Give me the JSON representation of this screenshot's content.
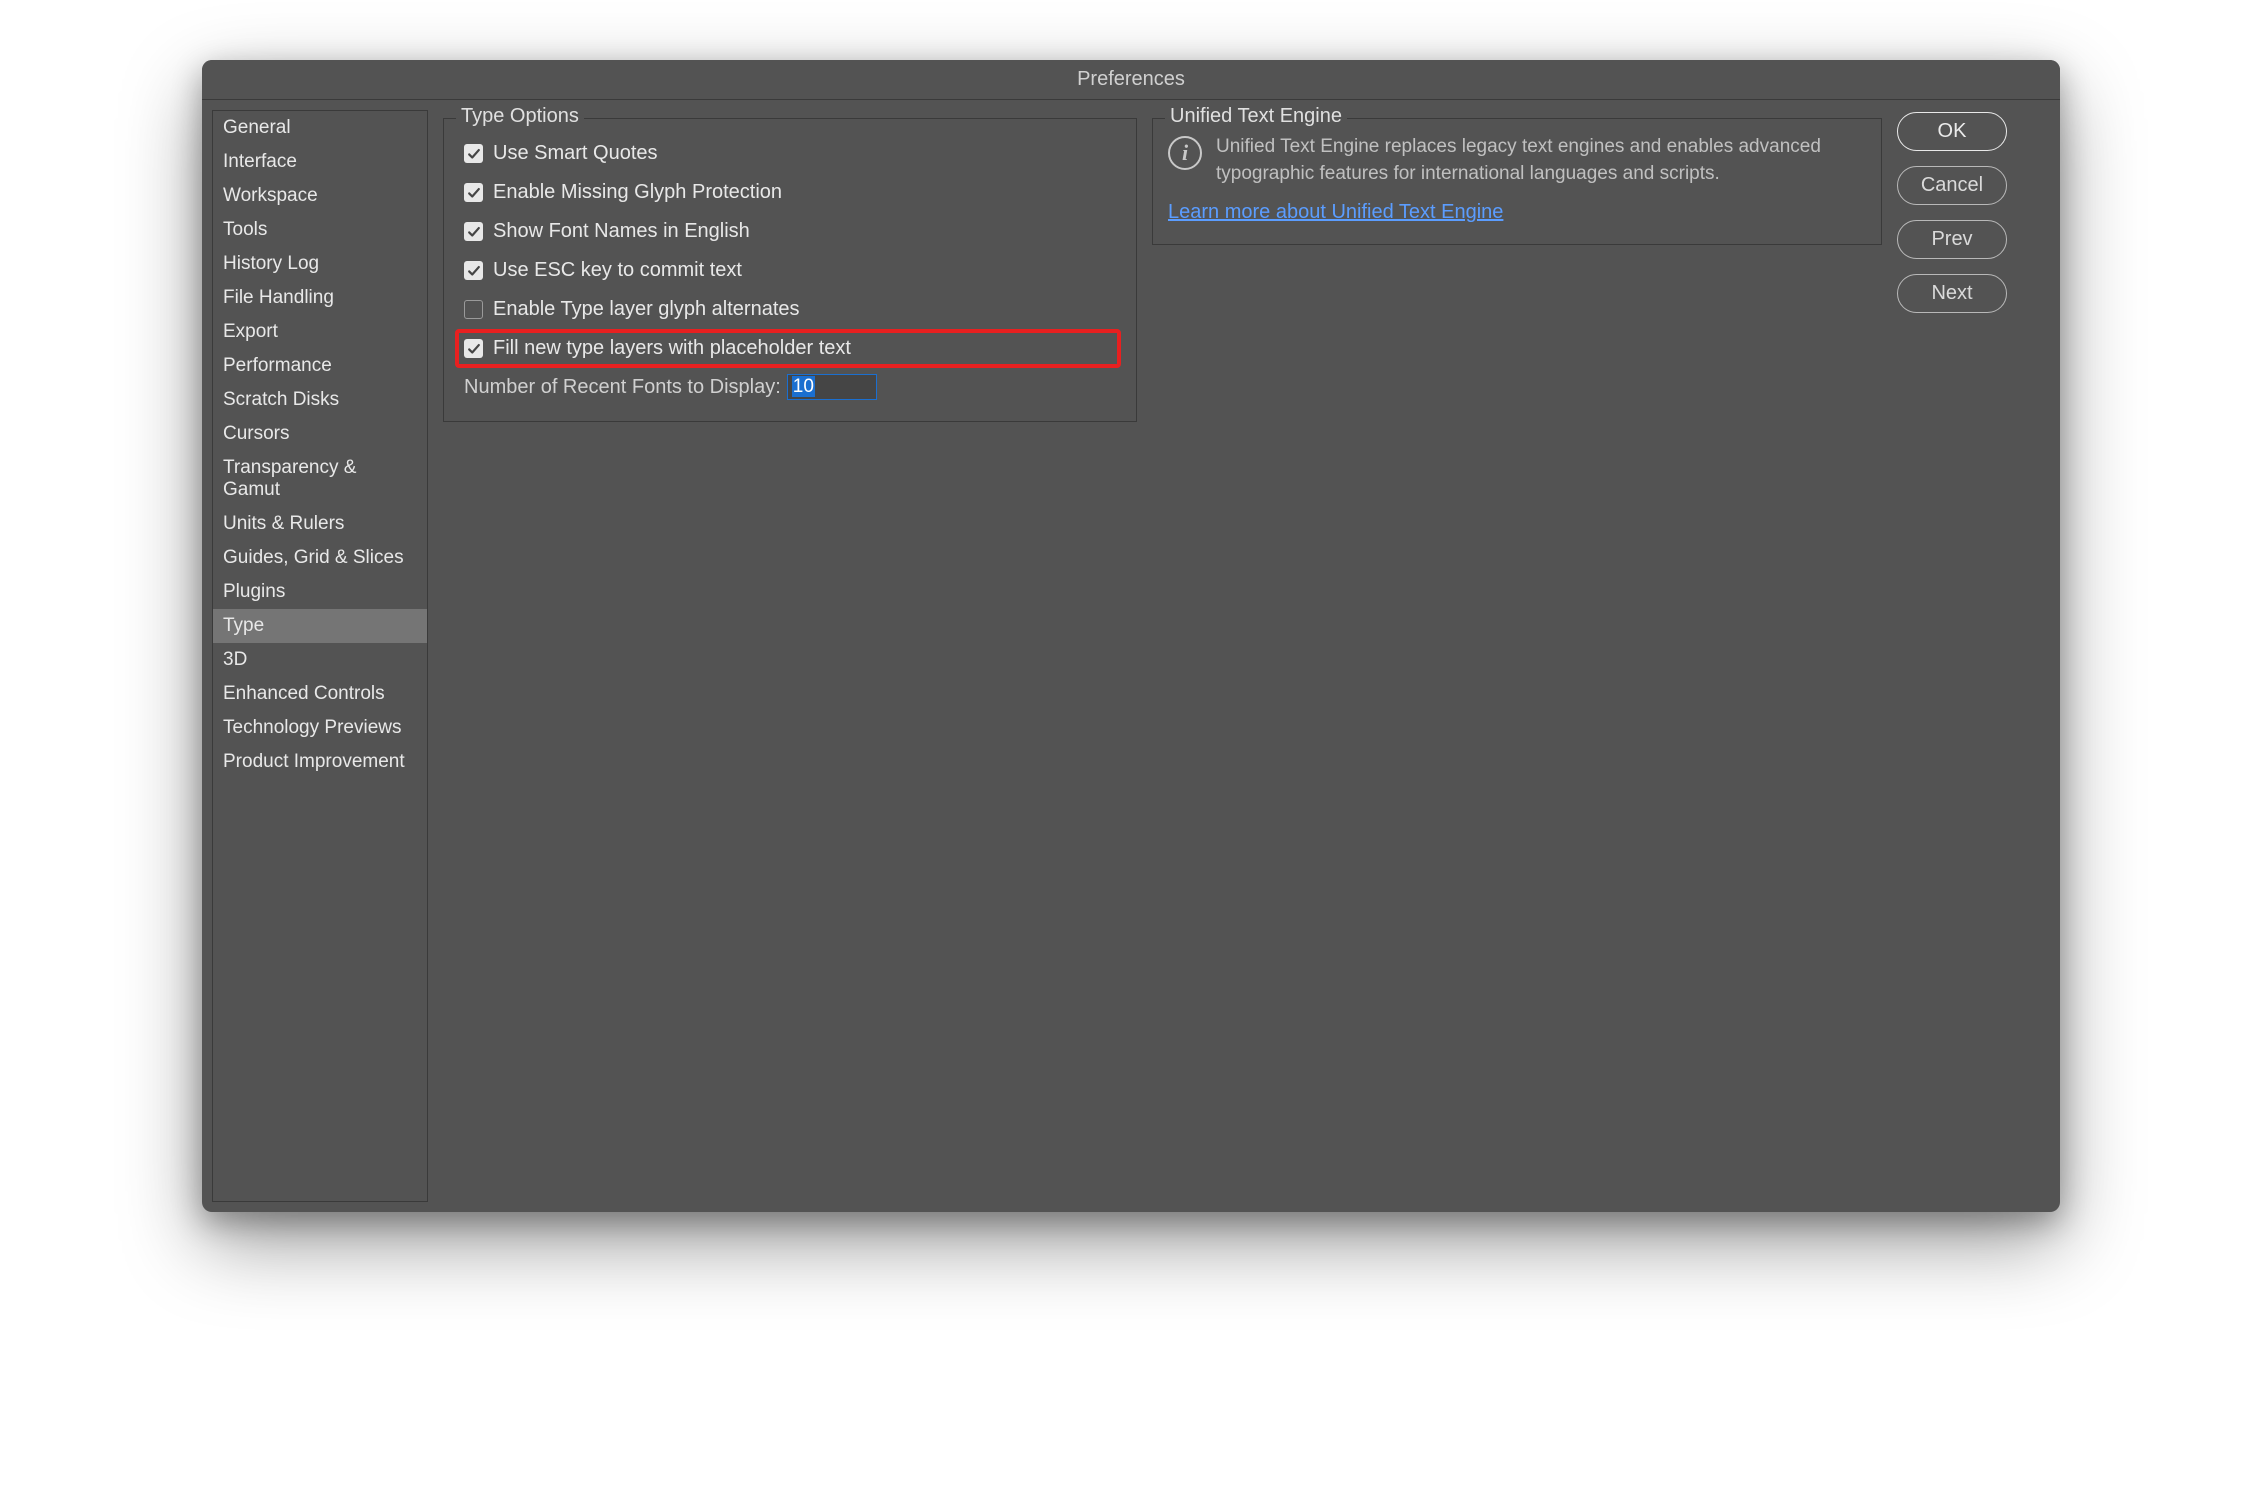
{
  "titlebar": "Preferences",
  "sidebar": {
    "items": [
      {
        "label": "General",
        "selected": false
      },
      {
        "label": "Interface",
        "selected": false
      },
      {
        "label": "Workspace",
        "selected": false
      },
      {
        "label": "Tools",
        "selected": false
      },
      {
        "label": "History Log",
        "selected": false
      },
      {
        "label": "File Handling",
        "selected": false
      },
      {
        "label": "Export",
        "selected": false
      },
      {
        "label": "Performance",
        "selected": false
      },
      {
        "label": "Scratch Disks",
        "selected": false
      },
      {
        "label": "Cursors",
        "selected": false
      },
      {
        "label": "Transparency & Gamut",
        "selected": false
      },
      {
        "label": "Units & Rulers",
        "selected": false
      },
      {
        "label": "Guides, Grid & Slices",
        "selected": false
      },
      {
        "label": "Plugins",
        "selected": false
      },
      {
        "label": "Type",
        "selected": true
      },
      {
        "label": "3D",
        "selected": false
      },
      {
        "label": "Enhanced Controls",
        "selected": false
      },
      {
        "label": "Technology Previews",
        "selected": false
      },
      {
        "label": "Product Improvement",
        "selected": false
      }
    ]
  },
  "type_options": {
    "legend": "Type Options",
    "checks": [
      {
        "label": "Use Smart Quotes",
        "checked": true,
        "highlight": false
      },
      {
        "label": "Enable Missing Glyph Protection",
        "checked": true,
        "highlight": false
      },
      {
        "label": "Show Font Names in English",
        "checked": true,
        "highlight": false
      },
      {
        "label": "Use ESC key to commit text",
        "checked": true,
        "highlight": false
      },
      {
        "label": "Enable Type layer glyph alternates",
        "checked": false,
        "highlight": false
      },
      {
        "label": "Fill new type layers with placeholder text",
        "checked": true,
        "highlight": true
      }
    ],
    "recent_fonts_label": "Number of Recent Fonts to Display:",
    "recent_fonts_value": "10"
  },
  "unified": {
    "legend": "Unified Text Engine",
    "description": "Unified Text Engine replaces legacy text engines and enables advanced typographic features for international languages and scripts.",
    "link_label": "Learn more about Unified Text Engine"
  },
  "buttons": {
    "ok": "OK",
    "cancel": "Cancel",
    "prev": "Prev",
    "next": "Next"
  }
}
